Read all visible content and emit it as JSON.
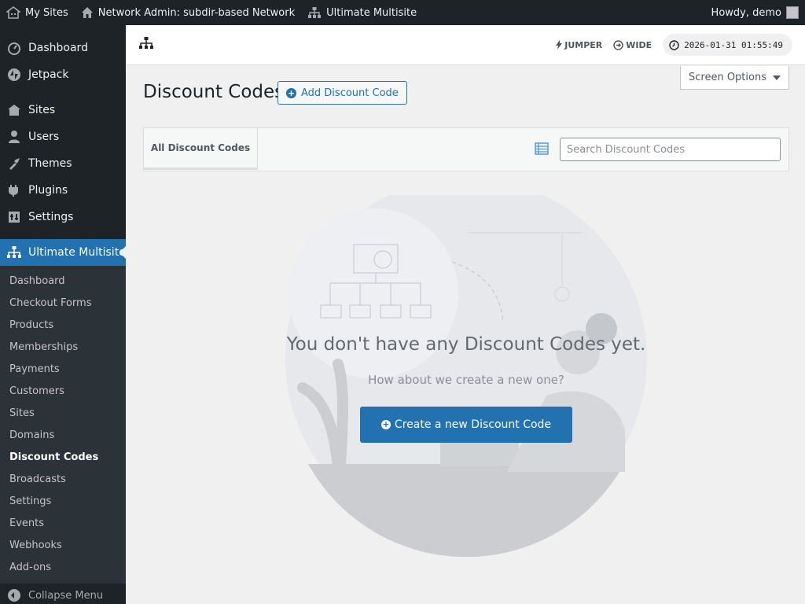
{
  "adminbar": {
    "my_sites": "My Sites",
    "network_admin": "Network Admin: subdir-based Network",
    "plugin": "Ultimate Multisite",
    "howdy": "Howdy, demo"
  },
  "sidebar": {
    "top_items": [
      {
        "label": "Dashboard",
        "icon": "dashboard-icon"
      },
      {
        "label": "Jetpack",
        "icon": "jetpack-icon"
      },
      {
        "label": "Sites",
        "icon": "sites-icon"
      },
      {
        "label": "Users",
        "icon": "users-icon"
      },
      {
        "label": "Themes",
        "icon": "themes-icon"
      },
      {
        "label": "Plugins",
        "icon": "plugins-icon"
      },
      {
        "label": "Settings",
        "icon": "settings-icon"
      }
    ],
    "current": {
      "label": "Ultimate Multisite",
      "icon": "network-icon"
    },
    "submenu": [
      "Dashboard",
      "Checkout Forms",
      "Products",
      "Memberships",
      "Payments",
      "Customers",
      "Sites",
      "Domains",
      "Discount Codes",
      "Broadcasts",
      "Settings",
      "Events",
      "Webhooks",
      "Add-ons"
    ],
    "active_submenu": "Discount Codes",
    "collapse": "Collapse Menu"
  },
  "topbar": {
    "jumper": "JUMPER",
    "wide": "WIDE",
    "clock": "2026-01-31 01:55:49"
  },
  "screen_options": "Screen Options",
  "page": {
    "title": "Discount Codes",
    "add_button": "Add Discount Code"
  },
  "filter": {
    "tab_all": "All Discount Codes",
    "search_placeholder": "Search Discount Codes"
  },
  "empty": {
    "title": "You don't have any Discount Codes yet.",
    "subtitle": "How about we create a new one?",
    "button": "Create a new Discount Code"
  },
  "colors": {
    "accent": "#2271b1",
    "sidebar": "#1d2327",
    "submenu": "#2c3338"
  }
}
